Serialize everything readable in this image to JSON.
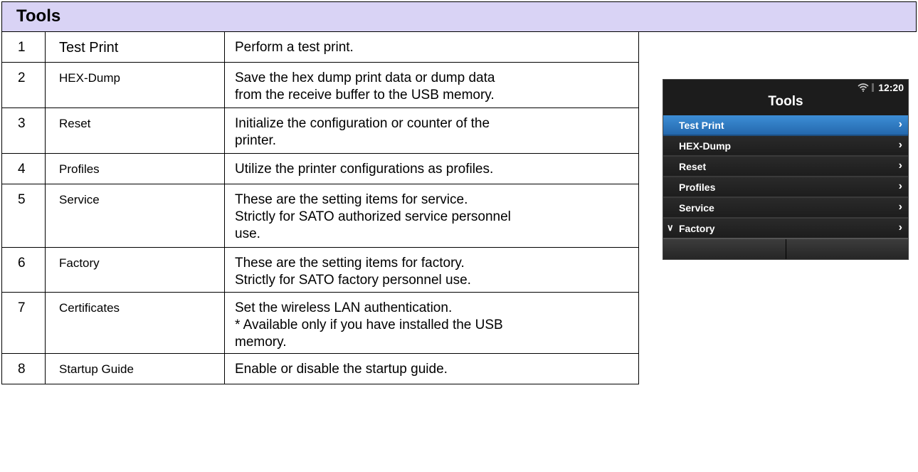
{
  "header": {
    "title": "Tools"
  },
  "rows": [
    {
      "num": "1",
      "name": "Test Print",
      "desc": [
        "Perform a test print."
      ]
    },
    {
      "num": "2",
      "name": "HEX-Dump",
      "desc": [
        "Save the hex dump print data or dump data",
        "from the receive buffer to the USB memory."
      ]
    },
    {
      "num": "3",
      "name": "Reset",
      "desc": [
        "Initialize the configuration or counter of the",
        "printer."
      ]
    },
    {
      "num": "4",
      "name": "Profiles",
      "desc": [
        "Utilize the printer configurations as profiles."
      ]
    },
    {
      "num": "5",
      "name": "Service",
      "desc": [
        "These are the setting items for service.",
        "Strictly for SATO authorized service personnel",
        "use."
      ]
    },
    {
      "num": "6",
      "name": "Factory",
      "desc": [
        "These are the setting items for factory.",
        "Strictly for SATO factory personnel use."
      ]
    },
    {
      "num": "7",
      "name": "Certificates",
      "desc": [
        "Set the wireless LAN authentication.",
        "* Available only if you have installed the USB",
        "memory."
      ]
    },
    {
      "num": "8",
      "name": "Startup Guide",
      "desc": [
        "Enable or disable the startup guide."
      ]
    }
  ],
  "screen": {
    "time": "12:20",
    "title": "Tools",
    "icons": [
      "wifi-icon",
      "battery-icon",
      "chevron-right-icon",
      "chevron-down-icon"
    ],
    "menu": [
      {
        "label": "Test Print",
        "active": true
      },
      {
        "label": "HEX-Dump"
      },
      {
        "label": "Reset"
      },
      {
        "label": "Profiles"
      },
      {
        "label": "Service"
      },
      {
        "label": "Factory",
        "marker": "∨"
      }
    ],
    "colors": {
      "active": "#2f7bc4",
      "background": "#1c1c1c",
      "header": "#d9d3f5"
    }
  }
}
